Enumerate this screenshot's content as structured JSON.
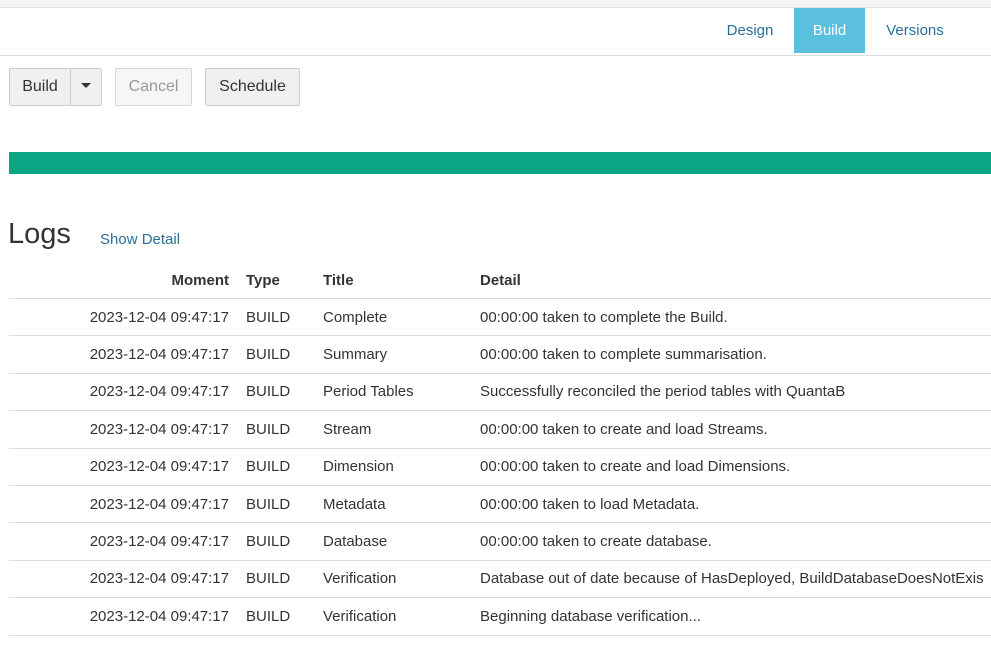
{
  "tabs": [
    {
      "label": "Design",
      "active": false
    },
    {
      "label": "Build",
      "active": true
    },
    {
      "label": "Versions",
      "active": false
    }
  ],
  "toolbar": {
    "build_label": "Build",
    "cancel_label": "Cancel",
    "schedule_label": "Schedule"
  },
  "progress": {
    "percent": 100,
    "color": "#0aa684"
  },
  "logs": {
    "heading": "Logs",
    "show_detail": "Show Detail",
    "columns": {
      "moment": "Moment",
      "type": "Type",
      "title": "Title",
      "detail": "Detail"
    },
    "rows": [
      {
        "moment": "2023-12-04 09:47:17",
        "type": "BUILD",
        "title": "Complete",
        "detail": "00:00:00 taken to complete the Build."
      },
      {
        "moment": "2023-12-04 09:47:17",
        "type": "BUILD",
        "title": "Summary",
        "detail": "00:00:00 taken to complete summarisation."
      },
      {
        "moment": "2023-12-04 09:47:17",
        "type": "BUILD",
        "title": "Period Tables",
        "detail": "Successfully reconciled the period tables with QuantaB"
      },
      {
        "moment": "2023-12-04 09:47:17",
        "type": "BUILD",
        "title": "Stream",
        "detail": "00:00:00 taken to create and load Streams."
      },
      {
        "moment": "2023-12-04 09:47:17",
        "type": "BUILD",
        "title": "Dimension",
        "detail": "00:00:00 taken to create and load Dimensions."
      },
      {
        "moment": "2023-12-04 09:47:17",
        "type": "BUILD",
        "title": "Metadata",
        "detail": "00:00:00 taken to load Metadata."
      },
      {
        "moment": "2023-12-04 09:47:17",
        "type": "BUILD",
        "title": "Database",
        "detail": "00:00:00 taken to create database."
      },
      {
        "moment": "2023-12-04 09:47:17",
        "type": "BUILD",
        "title": "Verification",
        "detail": "Database out of date because of HasDeployed, BuildDatabaseDoesNotExis"
      },
      {
        "moment": "2023-12-04 09:47:17",
        "type": "BUILD",
        "title": "Verification",
        "detail": "Beginning database verification..."
      }
    ]
  }
}
